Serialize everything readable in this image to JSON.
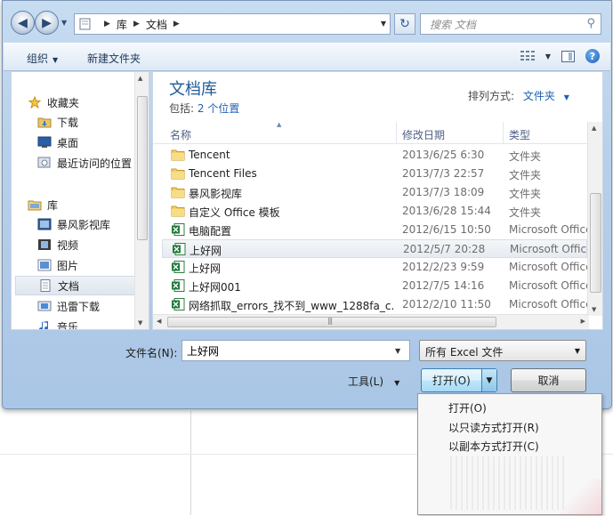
{
  "address": {
    "crumbs": [
      "库",
      "文档"
    ]
  },
  "search": {
    "placeholder": "搜索 文档"
  },
  "toolbar": {
    "organize": "组织",
    "new_folder": "新建文件夹"
  },
  "nav": {
    "favorites": {
      "label": "收藏夹",
      "items": [
        "下载",
        "桌面",
        "最近访问的位置"
      ]
    },
    "libraries": {
      "label": "库",
      "items": [
        "暴风影视库",
        "视频",
        "图片",
        "文档",
        "迅雷下载",
        "音乐"
      ]
    },
    "selected": "文档"
  },
  "library": {
    "title": "文档库",
    "includes_label": "包括:",
    "includes_link": "2 个位置",
    "arrange_label": "排列方式:",
    "arrange_value": "文件夹"
  },
  "columns": {
    "name": "名称",
    "date": "修改日期",
    "type": "类型"
  },
  "files": [
    {
      "name": "Tencent",
      "date": "2013/6/25 6:30",
      "type": "文件夹",
      "icon": "folder-icon"
    },
    {
      "name": "Tencent Files",
      "date": "2013/7/3 22:57",
      "type": "文件夹",
      "icon": "folder-icon"
    },
    {
      "name": "暴风影视库",
      "date": "2013/7/3 18:09",
      "type": "文件夹",
      "icon": "folder-icon"
    },
    {
      "name": "自定义 Office 模板",
      "date": "2013/6/28 15:44",
      "type": "文件夹",
      "icon": "folder-icon"
    },
    {
      "name": "电脑配置",
      "date": "2012/6/15 10:50",
      "type": "Microsoft Office",
      "icon": "excel-icon"
    },
    {
      "name": "上好网",
      "date": "2012/5/7 20:28",
      "type": "Microsoft Office",
      "icon": "excel-icon"
    },
    {
      "name": "上好网",
      "date": "2012/2/23 9:59",
      "type": "Microsoft Office",
      "icon": "excel-icon"
    },
    {
      "name": "上好网001",
      "date": "2012/7/5 14:16",
      "type": "Microsoft Office",
      "icon": "excel-icon"
    },
    {
      "name": "网络抓取_errors_找不到_www_1288fa_c...",
      "date": "2012/2/10 11:50",
      "type": "Microsoft Office",
      "icon": "excel-icon"
    }
  ],
  "selected_file": "上好网",
  "bottom": {
    "filename_label": "文件名(N):",
    "filename_value": "上好网",
    "filetype_value": "所有 Excel 文件",
    "tools_label": "工具(L)",
    "open_label": "打开(O)",
    "cancel_label": "取消"
  },
  "open_menu": {
    "items": [
      "打开(O)",
      "以只读方式打开(R)",
      "以副本方式打开(C)"
    ]
  }
}
